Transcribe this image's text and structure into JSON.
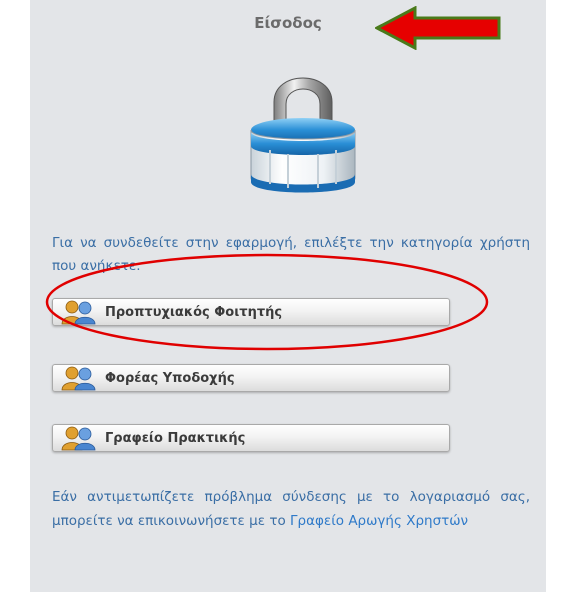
{
  "login_panel": {
    "title": "Είσοδος",
    "instruction": "Για να συνδεθείτε στην εφαρμογή, επιλέξτε την κατηγορία χρήστη που ανήκετε:",
    "user_types": [
      {
        "label": "Προπτυχιακός Φοιτητής",
        "icon": "users-icon"
      },
      {
        "label": "Φορέας Υποδοχής",
        "icon": "users-icon"
      },
      {
        "label": "Γραφείο Πρακτικής",
        "icon": "users-icon"
      }
    ],
    "help_text": "Εάν αντιμετωπίζετε πρόβλημα σύνδεσης με το λογαριασμό σας, μπορείτε να επικοινωνήσετε με το",
    "help_link": "Γραφείο Αρωγής Χρηστών"
  },
  "annotations": {
    "arrow_color": "#e60000",
    "arrow_border_color": "#4a7a1a",
    "ellipse_color": "#e00000"
  },
  "icons": {
    "lock": "padlock-icon",
    "annotation_arrow": "red-arrow-icon"
  },
  "colors": {
    "panel_bg": "#e3e5e8",
    "text_blue": "#3a6ea5",
    "link_blue": "#2f7ac9"
  }
}
